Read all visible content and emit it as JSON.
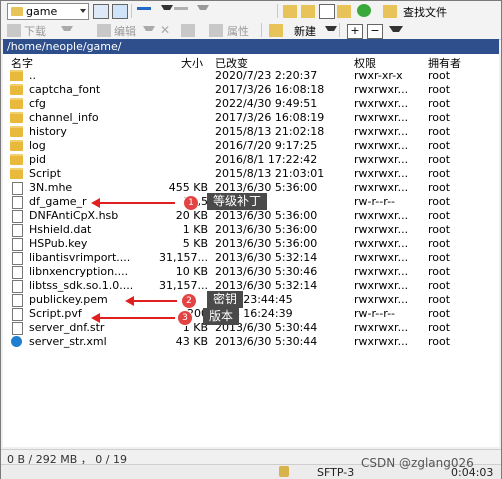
{
  "toolbar": {
    "location": "game",
    "find_files": "查找文件",
    "download": "下载",
    "edit": "编辑",
    "properties": "属性",
    "new": "新建"
  },
  "path": "/home/neople/game/",
  "columns": {
    "name": "名字",
    "size": "大小",
    "modified": "已改变",
    "perms": "权限",
    "owner": "拥有者"
  },
  "files": [
    {
      "name": "..",
      "size": "",
      "date": "2020/7/23 2:20:37",
      "perms": "rwxr-xr-x",
      "owner": "root",
      "type": "up"
    },
    {
      "name": "captcha_font",
      "size": "",
      "date": "2017/3/26 16:08:18",
      "perms": "rwxrwxr...",
      "owner": "root",
      "type": "folder"
    },
    {
      "name": "cfg",
      "size": "",
      "date": "2022/4/30 9:49:51",
      "perms": "rwxrwxr...",
      "owner": "root",
      "type": "folder"
    },
    {
      "name": "channel_info",
      "size": "",
      "date": "2017/3/26 16:08:19",
      "perms": "rwxrwxr...",
      "owner": "root",
      "type": "folder"
    },
    {
      "name": "history",
      "size": "",
      "date": "2015/8/13 21:02:18",
      "perms": "rwxrwxr...",
      "owner": "root",
      "type": "folder"
    },
    {
      "name": "log",
      "size": "",
      "date": "2016/7/20 9:17:25",
      "perms": "rwxrwxr...",
      "owner": "root",
      "type": "folder"
    },
    {
      "name": "pid",
      "size": "",
      "date": "2016/8/1 17:22:42",
      "perms": "rwxrwxr...",
      "owner": "root",
      "type": "folder"
    },
    {
      "name": "Script",
      "size": "",
      "date": "2015/8/13 21:03:01",
      "perms": "rwxrwxr...",
      "owner": "root",
      "type": "folder"
    },
    {
      "name": "3N.mhe",
      "size": "455 KB",
      "date": "2013/6/30 5:36:00",
      "perms": "rwxrwxr...",
      "owner": "root",
      "type": "file"
    },
    {
      "name": "df_game_r",
      "size": "35,5",
      "date": "16:27:19",
      "perms": "rw-r--r--",
      "owner": "root",
      "type": "file"
    },
    {
      "name": "DNFAntiCpX.hsb",
      "size": "20 KB",
      "date": "2013/6/30 5:36:00",
      "perms": "rwxrwxr...",
      "owner": "root",
      "type": "file"
    },
    {
      "name": "Hshield.dat",
      "size": "1 KB",
      "date": "2013/6/30 5:36:00",
      "perms": "rwxrwxr...",
      "owner": "root",
      "type": "file"
    },
    {
      "name": "HSPub.key",
      "size": "5 KB",
      "date": "2013/6/30 5:36:00",
      "perms": "rwxrwxr...",
      "owner": "root",
      "type": "file"
    },
    {
      "name": "libantisvrimport....",
      "size": "31,157...",
      "date": "2013/6/30 5:32:14",
      "perms": "rwxrwxr...",
      "owner": "root",
      "type": "file"
    },
    {
      "name": "libnxencryption....",
      "size": "10 KB",
      "date": "2013/6/30 5:30:46",
      "perms": "rwxrwxr...",
      "owner": "root",
      "type": "file"
    },
    {
      "name": "libtss_sdk.so.1.0....",
      "size": "31,157...",
      "date": "2013/6/30 5:32:14",
      "perms": "rwxrwxr...",
      "owner": "root",
      "type": "file"
    },
    {
      "name": "publickey.pem",
      "size": "",
      "date": "6/18 23:44:45",
      "perms": "rwxrwxr...",
      "owner": "root",
      "type": "file"
    },
    {
      "name": "Script.pvf",
      "size": "200",
      "date": "1/24 16:24:39",
      "perms": "rw-r--r--",
      "owner": "root",
      "type": "file"
    },
    {
      "name": "server_dnf.str",
      "size": "1 KB",
      "date": "2013/6/30 5:30:44",
      "perms": "rwxrwxr...",
      "owner": "root",
      "type": "file"
    },
    {
      "name": "server_str.xml",
      "size": "43 KB",
      "date": "2013/6/30 5:30:44",
      "perms": "rwxrwxr...",
      "owner": "root",
      "type": "edge"
    }
  ],
  "annotations": [
    {
      "num": "1",
      "label": "等级补丁"
    },
    {
      "num": "2",
      "label": "密钥"
    },
    {
      "num": "3",
      "label": "版本"
    }
  ],
  "status": "0 B / 292 MB ， 0 / 19",
  "bottom": {
    "protocol": "SFTP-3",
    "time": "0:04:03"
  },
  "watermark": "CSDN @zglang026"
}
